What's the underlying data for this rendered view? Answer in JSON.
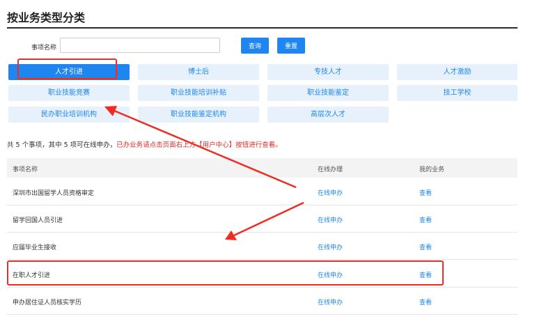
{
  "page_title": "按业务类型分类",
  "search": {
    "label": "事项名称",
    "value": "",
    "query_btn": "查询",
    "reset_btn": "重置"
  },
  "categories": [
    {
      "label": "人才引进",
      "active": true
    },
    {
      "label": "博士后",
      "active": false
    },
    {
      "label": "专技人才",
      "active": false
    },
    {
      "label": "人才激励",
      "active": false
    },
    {
      "label": "职业技能竞赛",
      "active": false
    },
    {
      "label": "职业技能培训补贴",
      "active": false
    },
    {
      "label": "职业技能鉴定",
      "active": false
    },
    {
      "label": "技工学校",
      "active": false
    },
    {
      "label": "民办职业培训机构",
      "active": false
    },
    {
      "label": "职业技能鉴定机构",
      "active": false
    },
    {
      "label": "高层次人才",
      "active": false
    }
  ],
  "summary": {
    "count_text": "共 5 个事项，其中 5 项可在线申办，",
    "hint_text": "已办业务请点击页面右上方【用户中心】按钮进行查看。"
  },
  "table": {
    "headers": [
      "事项名称",
      "在线办理",
      "我的业务"
    ],
    "rows": [
      {
        "name": "深圳市出国留学人员资格审定",
        "online": "在线申办",
        "view": "查看"
      },
      {
        "name": "留学回国人员引进",
        "online": "在线申办",
        "view": "查看"
      },
      {
        "name": "应届毕业生接收",
        "online": "在线申办",
        "view": "查看"
      },
      {
        "name": "在职人才引进",
        "online": "在线申办",
        "view": "查看"
      },
      {
        "name": "申办居住证人员核实学历",
        "online": "在线申办",
        "view": "查看"
      }
    ]
  },
  "colors": {
    "accent": "#1e86ee",
    "annotation": "#f02b22",
    "tab_bg": "#e6f1fc"
  }
}
